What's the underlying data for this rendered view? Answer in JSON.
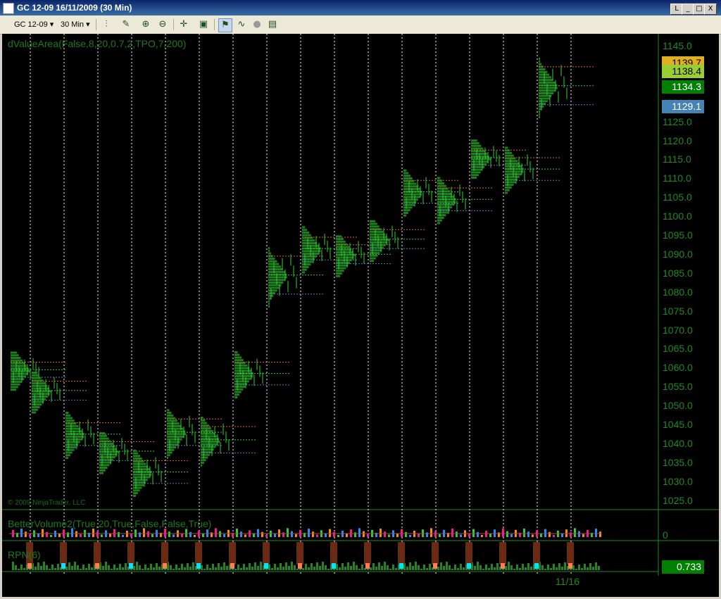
{
  "window": {
    "title": "GC 12-09  16/11/2009 (30 Min)",
    "buttons": [
      "L",
      "_",
      "□",
      "X"
    ]
  },
  "toolbar": {
    "instrument": "GC 12-09",
    "interval": "30 Min",
    "icons": [
      "bar-type-icon",
      "draw-pencil-icon",
      "zoom-in-icon",
      "zoom-out-icon",
      "crosshair-icon",
      "data-box-icon",
      "strategy-icon",
      "indicator-icon",
      "disabled-icon",
      "properties-icon"
    ]
  },
  "chart": {
    "indicator_main": "dValueArea(False,8,20,0.7,2,TPO,7,200)",
    "indicator_volume": "BetterVolume2(True,20,True,False,False,True)",
    "indicator_rpn": "RPN(6)",
    "copyright": "© 2009 NinjaTrader, LLC",
    "price_ticks": [
      "1145.0",
      "1140.0",
      "1135.0",
      "1130.0",
      "1125.0",
      "1120.0",
      "1115.0",
      "1110.0",
      "1105.0",
      "1100.0",
      "1095.0",
      "1090.0",
      "1085.0",
      "1080.0",
      "1075.0",
      "1070.0",
      "1065.0",
      "1060.0",
      "1055.0",
      "1050.0",
      "1045.0",
      "1040.0",
      "1035.0",
      "1030.0",
      "1025.0"
    ],
    "price_tags": [
      {
        "label": "1139.7",
        "color": "#e0b020"
      },
      {
        "label": "1138.4",
        "color": "#9acd32"
      },
      {
        "label": "1134.3",
        "color": "#008000"
      },
      {
        "label": "1129.1",
        "color": "#4682b4"
      }
    ],
    "volume_zero": "0",
    "rpn_value": "0.733",
    "date_label": "11/16",
    "colors": {
      "background": "#000000",
      "price": "#1e8a1e",
      "profile": "#1f8f1f",
      "divider": "#ffffff"
    }
  }
}
